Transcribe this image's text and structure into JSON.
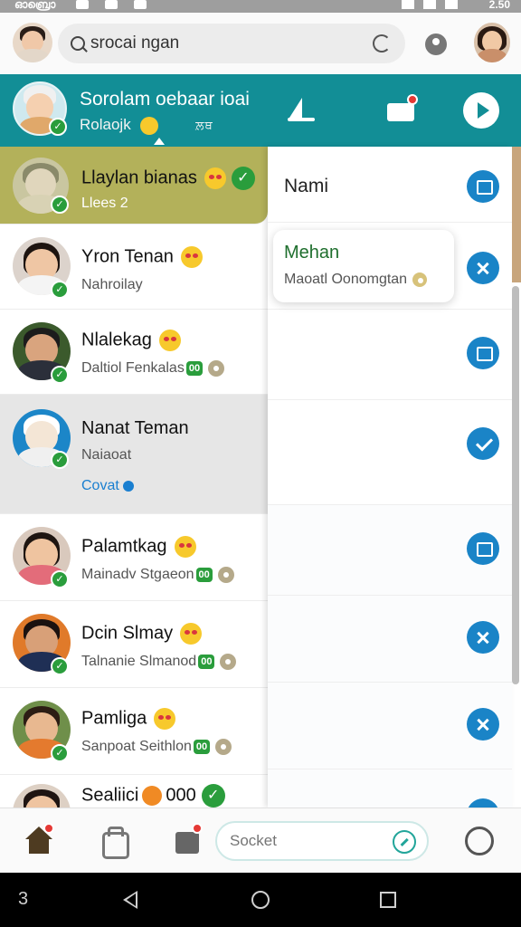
{
  "status_bar": {
    "carrier": "ഓബ്രൊ",
    "time": "2.50"
  },
  "search": {
    "value": "srocai ngan"
  },
  "header": {
    "title": "Sorolam oebaar ioai",
    "subtitle": "Rolaojk",
    "tag": "ਲ਼ਥ",
    "colors": {
      "teal": "#128e96"
    }
  },
  "chats": [
    {
      "name": "Llaylan bianas",
      "sub": "Llees 2",
      "has_emoji": true,
      "has_check": true,
      "selected": true
    },
    {
      "name": "Yron Tenan",
      "sub": "Nahroilay",
      "has_emoji": true
    },
    {
      "name": "Nlalekag",
      "sub": "Daltiol Fenkalas",
      "tag": "00",
      "has_emoji": true
    },
    {
      "name": "Nanat Teman",
      "sub": "Naiaoat",
      "link": "Covat",
      "highlighted": true
    },
    {
      "name": "Palamtkag",
      "sub": "Mainadv Stgaeon",
      "tag": "00",
      "has_emoji": true
    },
    {
      "name": "Dcin Slmay",
      "sub": "Talnanie Slmanod",
      "tag": "00",
      "has_emoji": true
    },
    {
      "name": "Pamliga",
      "sub": "Sanpoat Seithlon",
      "tag": "00",
      "has_emoji": true
    },
    {
      "name": "Sealiici",
      "tag_text": "000",
      "has_check": true
    }
  ],
  "drawer": {
    "title": "Nami",
    "popup": {
      "name": "Mehan",
      "sub": "Maoatl Oonomgtan"
    }
  },
  "bottom": {
    "input_placeholder": "Socket"
  },
  "nav": {
    "label": "3"
  }
}
